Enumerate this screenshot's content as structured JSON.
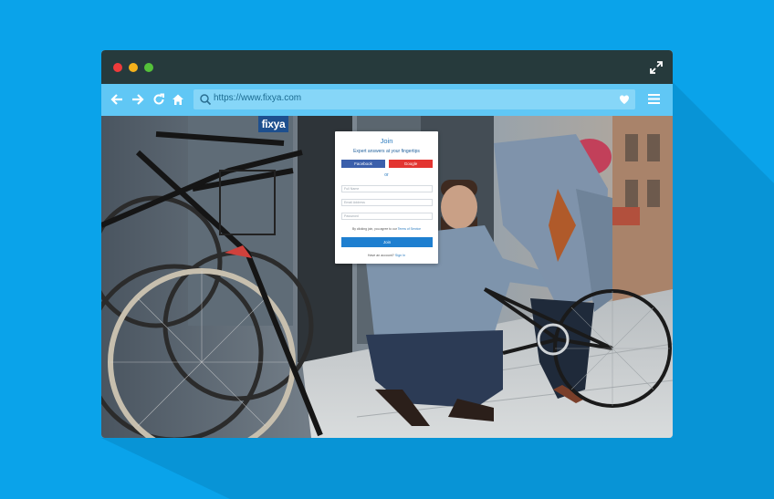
{
  "colors": {
    "background": "#0aa3ea",
    "titlebar": "#263a3c",
    "toolbar": "#60c7f5",
    "accent": "#1e7fd0",
    "facebook": "#3b5fab",
    "google": "#e33531",
    "logo": "#1d4f8e"
  },
  "window": {
    "controls": [
      "close",
      "minimize",
      "maximize"
    ]
  },
  "toolbar": {
    "icons": [
      "back-arrow-icon",
      "forward-arrow-icon",
      "reload-icon",
      "home-icon",
      "search-icon",
      "heart-icon",
      "hamburger-menu-icon"
    ],
    "url": "https://www.fixya.com"
  },
  "site": {
    "logo": "fixya"
  },
  "modal": {
    "title": "Join",
    "subtitle": "Expert answers at your fingertips",
    "facebook_label": "Facebook",
    "google_label": "Google",
    "or_label": "or",
    "full_name_placeholder": "Full Name",
    "email_placeholder": "Email Address",
    "password_placeholder": "Password",
    "terms_prefix": "By clicking join, you agree to our",
    "terms_link": "Terms of Service",
    "join_label": "Join",
    "footer_prefix": "Have an account?",
    "signin_link": "Sign In"
  }
}
